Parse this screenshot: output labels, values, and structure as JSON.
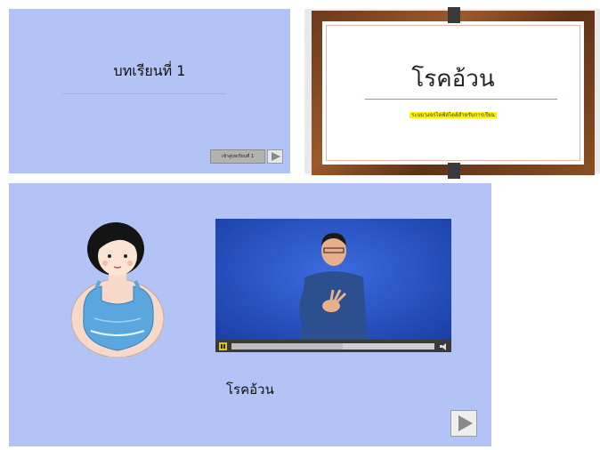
{
  "lesson_slide": {
    "title": "บทเรียนที่ 1",
    "start_button_label": "เข้าสู่บทเรียนที่ 1"
  },
  "title_slide": {
    "title": "โรคอ้วน",
    "subtitle": "ระบบวงจรไลฟ์สไตล์สำหรับการเรียน"
  },
  "video_slide": {
    "caption": "โรคอ้วน",
    "video_progress": 0.55,
    "icons": [
      "pause-icon",
      "volume-icon",
      "next-arrow-icon"
    ]
  },
  "colors": {
    "slide_background": "#b4c3f6",
    "video_background": "#2a53c4",
    "highlight": "#fff200"
  }
}
